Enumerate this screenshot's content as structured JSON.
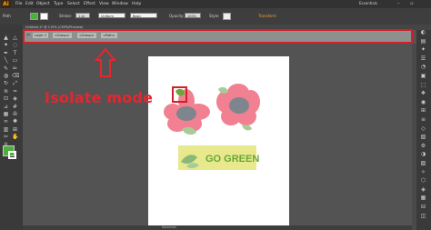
{
  "app": {
    "logo": "Ai",
    "workspace": "Essentials",
    "window_controls": "– ▫ ×"
  },
  "menu": [
    "File",
    "Edit",
    "Object",
    "Type",
    "Select",
    "Effect",
    "View",
    "Window",
    "Help"
  ],
  "control": {
    "selection_label": "Path",
    "stroke_label": "Stroke:",
    "stroke_value": "1 pt",
    "uniform_label": "Uniform",
    "brush_label": "Basic",
    "opacity_label": "Opacity:",
    "opacity_value": "100%",
    "style_label": "Style:",
    "transform_label": "Transform",
    "fill_color": "#4caf3c"
  },
  "document": {
    "tab_title": "Untitled-1* @ 119% (CMYK/Preview)"
  },
  "isolation": {
    "crumbs": [
      "Layer 1",
      "<Group>",
      "<Group>",
      "<Path>"
    ]
  },
  "annotation": {
    "text": "Isolate mode",
    "color": "#e6262e"
  },
  "artwork": {
    "banner_text": "GO GREEN",
    "banner_color": "#e8e88c",
    "text_color": "#6aa638",
    "petal_color": "#f08092",
    "center_color": "#7f858c",
    "leaf_color": "#8ab87a"
  },
  "status": {
    "text": "Selection"
  },
  "tools": [
    "selection-icon",
    "direct-select-icon",
    "magic-wand-icon",
    "lasso-icon",
    "pen-icon",
    "type-icon",
    "line-icon",
    "rectangle-icon",
    "paintbrush-icon",
    "pencil-icon",
    "blob-brush-icon",
    "eraser-icon",
    "rotate-icon",
    "scale-icon",
    "width-icon",
    "warp-icon",
    "free-transform-icon",
    "shape-builder-icon",
    "perspective-icon",
    "mesh-icon",
    "gradient-icon",
    "eyedropper-icon",
    "blend-icon",
    "symbol-sprayer-icon",
    "graph-icon",
    "artboard-icon",
    "slice-icon",
    "hand-icon",
    "zoom-icon"
  ]
}
